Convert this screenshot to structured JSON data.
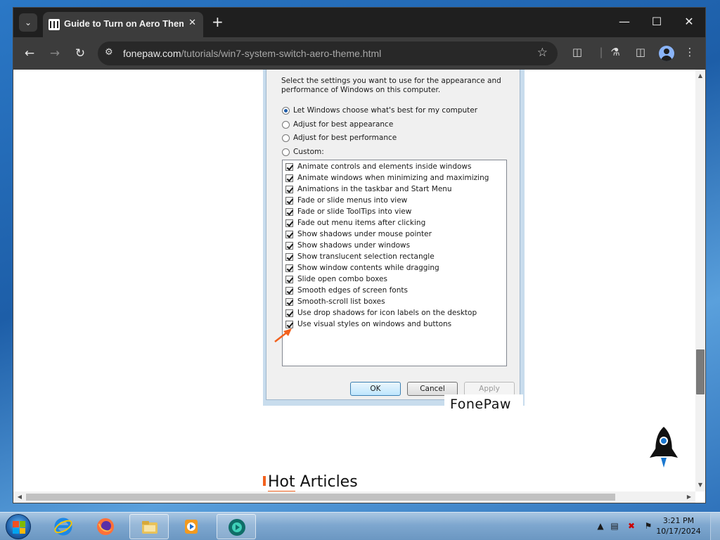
{
  "browser": {
    "tab": {
      "title": "Guide to Turn on Aero Theme on"
    },
    "url": {
      "host": "fonepaw.com",
      "path": "/tutorials/win7-system-switch-aero-theme.html"
    }
  },
  "dialog": {
    "description": "Select the settings you want to use for the appearance and performance of Windows on this computer.",
    "radios": [
      {
        "label": "Let Windows choose what's best for my computer",
        "checked": true
      },
      {
        "label": "Adjust for best appearance",
        "checked": false
      },
      {
        "label": "Adjust for best performance",
        "checked": false
      },
      {
        "label": "Custom:",
        "checked": false
      }
    ],
    "checkboxes": [
      {
        "label": "Animate controls and elements inside windows",
        "checked": true
      },
      {
        "label": "Animate windows when minimizing and maximizing",
        "checked": true
      },
      {
        "label": "Animations in the taskbar and Start Menu",
        "checked": true
      },
      {
        "label": "Fade or slide menus into view",
        "checked": true
      },
      {
        "label": "Fade or slide ToolTips into view",
        "checked": true
      },
      {
        "label": "Fade out menu items after clicking",
        "checked": true
      },
      {
        "label": "Show shadows under mouse pointer",
        "checked": true
      },
      {
        "label": "Show shadows under windows",
        "checked": true
      },
      {
        "label": "Show translucent selection rectangle",
        "checked": true
      },
      {
        "label": "Show window contents while dragging",
        "checked": true
      },
      {
        "label": "Slide open combo boxes",
        "checked": true
      },
      {
        "label": "Smooth edges of screen fonts",
        "checked": true
      },
      {
        "label": "Smooth-scroll list boxes",
        "checked": true
      },
      {
        "label": "Use drop shadows for icon labels on the desktop",
        "checked": true
      },
      {
        "label": "Use visual styles on windows and buttons",
        "checked": true
      }
    ],
    "buttons": {
      "ok": "OK",
      "cancel": "Cancel",
      "apply": "Apply"
    },
    "watermark": "FonePaw"
  },
  "page": {
    "hot_articles": {
      "highlight": "Hot",
      "rest": " Articles"
    }
  },
  "taskbar": {
    "clock": {
      "time": "3:21 PM",
      "date": "10/17/2024"
    },
    "items": [
      "start-button",
      "internet-explorer",
      "firefox",
      "file-explorer",
      "media-player",
      "fonepaw-app"
    ]
  },
  "colors": {
    "accent_orange": "#f2611d",
    "browser_dark": "#3c3c3c"
  }
}
